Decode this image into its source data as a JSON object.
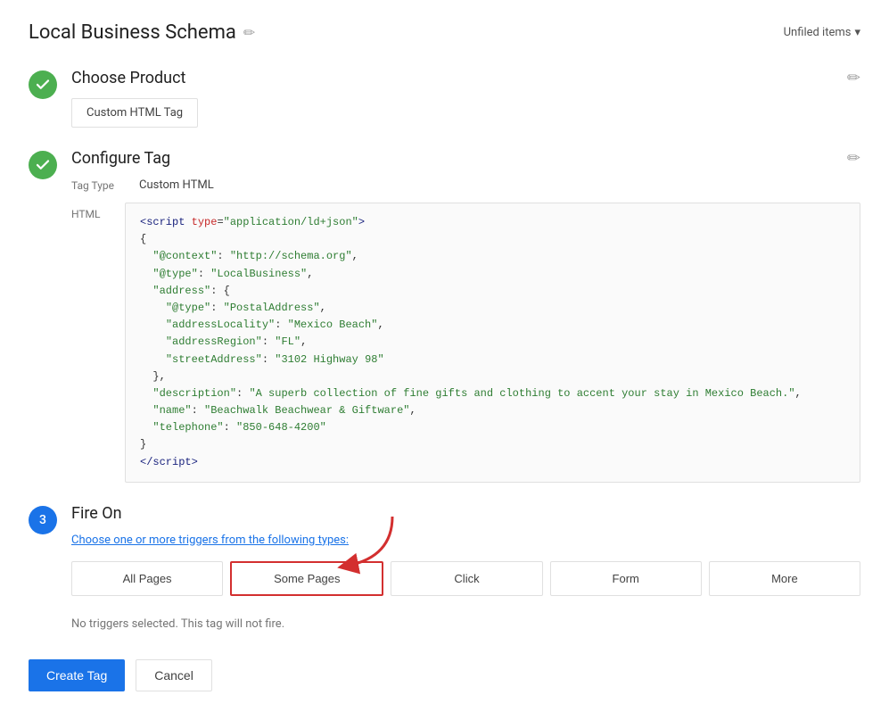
{
  "header": {
    "title": "Local Business Schema",
    "edit_icon": "✏",
    "unfiled_label": "Unfiled items",
    "unfiled_arrow": "▾"
  },
  "step1": {
    "title": "Choose Product",
    "product_label": "Custom HTML Tag",
    "edit_icon": "✏"
  },
  "step2": {
    "title": "Configure Tag",
    "edit_icon": "✏",
    "tag_type_label": "Tag Type",
    "tag_type_value": "Custom HTML",
    "html_label": "HTML",
    "code_lines": [
      "<script type=\"application/ld+json\">",
      "{",
      "  \"@context\": \"http://schema.org\",",
      "  \"@type\": \"LocalBusiness\",",
      "  \"address\": {",
      "    \"@type\": \"PostalAddress\",",
      "    \"addressLocality\": \"Mexico Beach\",",
      "    \"addressRegion\": \"FL\",",
      "    \"streetAddress\": \"3102 Highway 98\"",
      "  },",
      "  \"description\": \"A superb collection of fine gifts and clothing to accent your stay in Mexico Beach.\",",
      "  \"name\": \"Beachwalk Beachwear & Giftware\",",
      "  \"telephone\": \"850-648-4200\"",
      "}",
      "<\\/script>"
    ]
  },
  "step3": {
    "number": "3",
    "title": "Fire On",
    "description_text": "Choose one or more triggers from the following types:",
    "triggers": [
      {
        "label": "All Pages",
        "highlighted": false
      },
      {
        "label": "Some Pages",
        "highlighted": true
      },
      {
        "label": "Click",
        "highlighted": false
      },
      {
        "label": "Form",
        "highlighted": false
      },
      {
        "label": "More",
        "highlighted": false
      }
    ],
    "no_triggers_text": "No triggers selected. This tag will not fire."
  },
  "footer": {
    "create_label": "Create Tag",
    "cancel_label": "Cancel"
  }
}
